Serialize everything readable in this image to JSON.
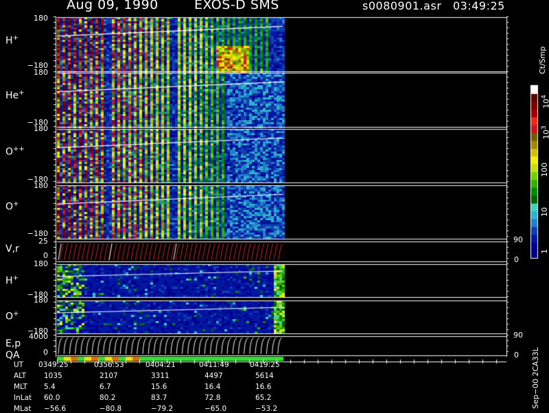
{
  "header": {
    "date": "Aug 09, 1990",
    "instrument": "EXOS-D SMS",
    "file": "s0080901.asr",
    "time": "03:49:25"
  },
  "panels": [
    {
      "id": "h-plus",
      "label": "H",
      "sup": "+",
      "ytop": "180",
      "ybot": "−180"
    },
    {
      "id": "he-plus",
      "label": "He",
      "sup": "+",
      "ytop": "180",
      "ybot": "−180"
    },
    {
      "id": "o-plusplus",
      "label": "O",
      "sup": "++",
      "ytop": "180",
      "ybot": "−180"
    },
    {
      "id": "o-plus",
      "label": "O",
      "sup": "+",
      "ytop": "180",
      "ybot": "−180"
    },
    {
      "id": "vr",
      "label": "V,r",
      "sup": "",
      "ytop": "25",
      "ybot": "0",
      "rtop": "90",
      "rbot": "0"
    },
    {
      "id": "h-plus-2",
      "label": "H",
      "sup": "+",
      "ytop": "180",
      "ybot": "−180"
    },
    {
      "id": "o-plus-2",
      "label": "O",
      "sup": "+",
      "ytop": "180",
      "ybot": "−180"
    },
    {
      "id": "ep",
      "label": "E,p",
      "sup": "",
      "ytop": "4000",
      "ybot": "0",
      "rtop": "90",
      "rbot": "0"
    },
    {
      "id": "qa",
      "label": "QA",
      "sup": ""
    }
  ],
  "colorbar": {
    "unit": "Ct/Smp",
    "labels": [
      "10",
      "10",
      "100",
      "10",
      "1"
    ],
    "label_sups": [
      "4",
      "3",
      "",
      "",
      ""
    ],
    "colors": [
      "#000080",
      "#000090",
      "#0018a0",
      "#1040b0",
      "#2080c8",
      "#30b0d0",
      "#40d0c0",
      "#006400",
      "#008c00",
      "#30b000",
      "#70d000",
      "#c8e000",
      "#f0f000",
      "#d4c000",
      "#a08800",
      "#6c6000",
      "#c81818",
      "#f02818",
      "#a00000",
      "#800000",
      "#600000",
      "#ffffff"
    ]
  },
  "orbit_table": {
    "rows": [
      {
        "name": "UT",
        "values": [
          "0349:25",
          "0356:53",
          "0404:21",
          "0411:49",
          "0419:25"
        ]
      },
      {
        "name": "ALT",
        "values": [
          "1035",
          "2107",
          "3311",
          "4497",
          "5614"
        ]
      },
      {
        "name": "MLT",
        "values": [
          "5.4",
          "6.7",
          "15.6",
          "16.4",
          "16.6"
        ]
      },
      {
        "name": "InLat",
        "values": [
          "60.0",
          "80.2",
          "83.7",
          "72.8",
          "65.2"
        ]
      },
      {
        "name": "MLat",
        "values": [
          "−56.6",
          "−80.8",
          "−79.2",
          "−65.0",
          "−53.2"
        ]
      }
    ]
  },
  "footer_stamp": "Sep−00 2CA33L"
}
